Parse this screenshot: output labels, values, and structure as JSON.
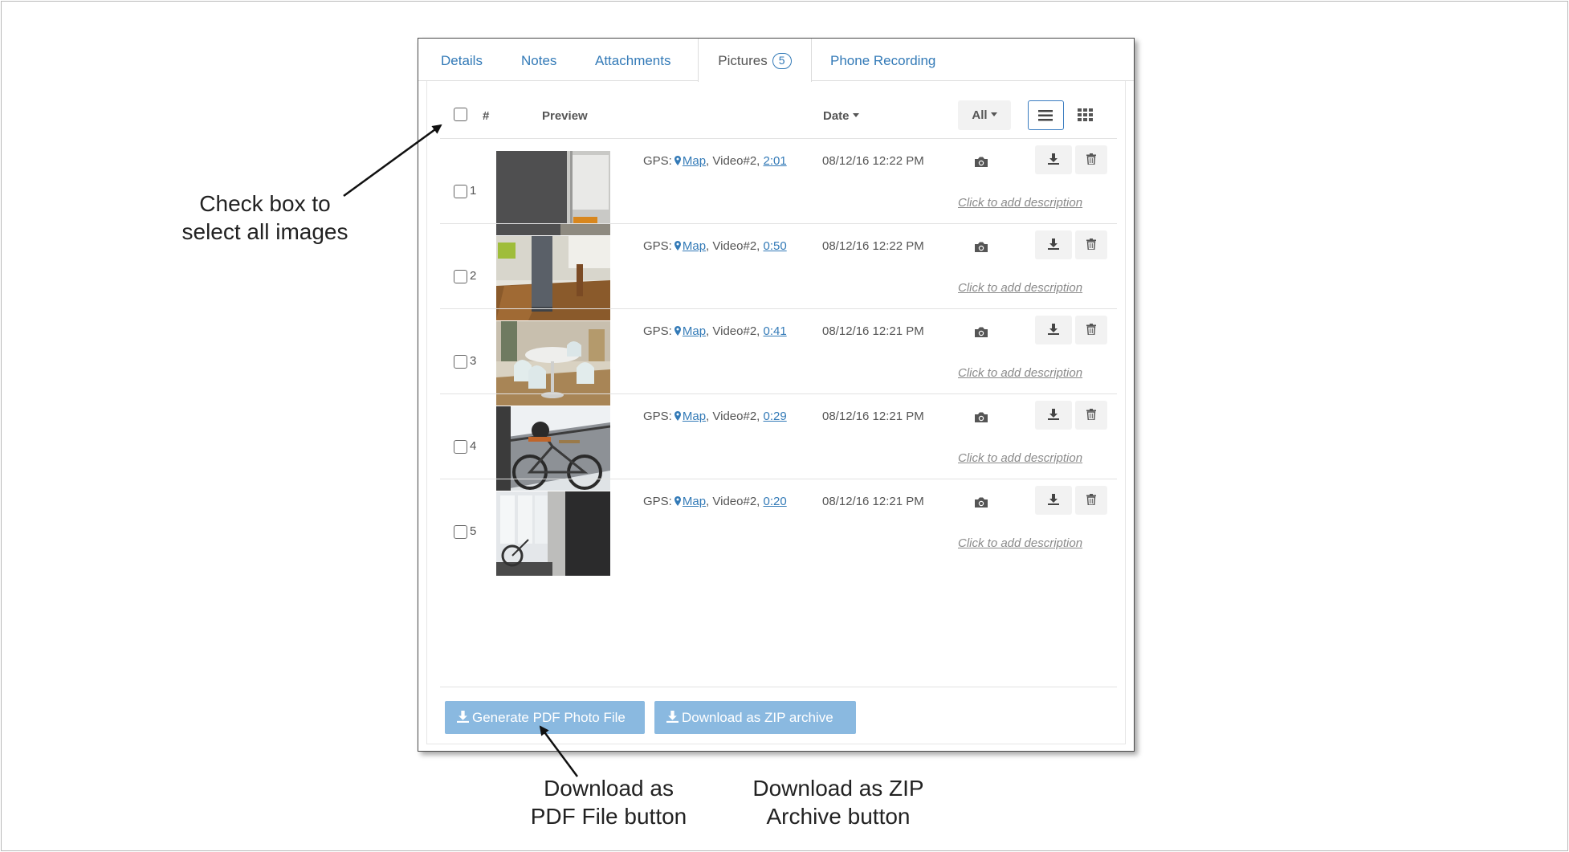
{
  "tabs": [
    {
      "label": "Details"
    },
    {
      "label": "Notes"
    },
    {
      "label": "Attachments"
    },
    {
      "label": "Pictures",
      "badge": "5"
    },
    {
      "label": "Phone Recording"
    }
  ],
  "active_tab": "Pictures",
  "table": {
    "col_number": "#",
    "col_preview": "Preview",
    "col_date": "Date",
    "filter_label": "All",
    "view_modes": [
      "list-icon",
      "grid-icon"
    ],
    "active_view": "list-icon"
  },
  "rows": [
    {
      "num": "1",
      "gps_label": "GPS:",
      "map": "Map",
      "video": ", Video#2, ",
      "time": "2:01",
      "date": "08/12/16 12:22 PM",
      "desc": "Click to add description"
    },
    {
      "num": "2",
      "gps_label": "GPS:",
      "map": "Map",
      "video": ", Video#2, ",
      "time": "0:50",
      "date": "08/12/16 12:22 PM",
      "desc": "Click to add description"
    },
    {
      "num": "3",
      "gps_label": "GPS:",
      "map": "Map",
      "video": ", Video#2, ",
      "time": "0:41",
      "date": "08/12/16 12:21 PM",
      "desc": "Click to add description"
    },
    {
      "num": "4",
      "gps_label": "GPS:",
      "map": "Map",
      "video": ", Video#2, ",
      "time": "0:29",
      "date": "08/12/16 12:21 PM",
      "desc": "Click to add description"
    },
    {
      "num": "5",
      "gps_label": "GPS:",
      "map": "Map",
      "video": ", Video#2, ",
      "time": "0:20",
      "date": "08/12/16 12:21 PM",
      "desc": "Click to add description"
    }
  ],
  "buttons": {
    "pdf": "Generate PDF Photo File",
    "zip": "Download as ZIP archive"
  },
  "annotations": {
    "select_all": [
      "Check box to",
      "select all images"
    ],
    "pdf": [
      "Download as",
      "PDF File button"
    ],
    "zip": [
      "Download as ZIP",
      "Archive button"
    ]
  },
  "colors": {
    "link": "#337ab7",
    "button_blue": "#8ab9e0",
    "text": "#555555"
  }
}
